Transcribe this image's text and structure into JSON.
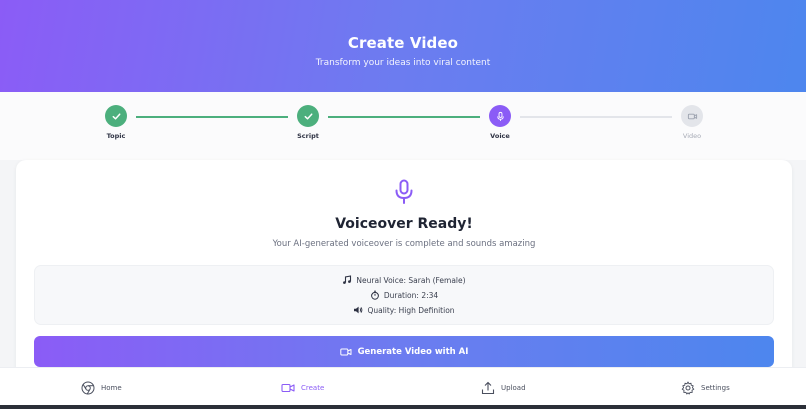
{
  "header": {
    "title": "Create Video",
    "subtitle": "Transform your ideas into viral content"
  },
  "steps": [
    {
      "label": "Topic",
      "status": "done",
      "icon": "check-icon"
    },
    {
      "label": "Script",
      "status": "done",
      "icon": "check-icon"
    },
    {
      "label": "Voice",
      "status": "active",
      "icon": "microphone-icon"
    },
    {
      "label": "Video",
      "status": "pending",
      "icon": "video-camera-icon"
    }
  ],
  "card": {
    "icon": "microphone-icon",
    "title": "Voiceover Ready!",
    "description": "Your AI-generated voiceover is complete and sounds amazing",
    "info": {
      "voice": "Neural Voice: Sarah (Female)",
      "duration": "Duration: 2:34",
      "quality": "Quality: High Definition"
    },
    "generate_button": "Generate Video with AI"
  },
  "nav": {
    "home": "Home",
    "create": "Create",
    "upload": "Upload",
    "settings": "Settings",
    "active": "create"
  },
  "colors": {
    "accent": "#8b5cf6",
    "accent_blue": "#4d86ee",
    "done": "#4caf7d",
    "pending": "#e3e5ea"
  }
}
